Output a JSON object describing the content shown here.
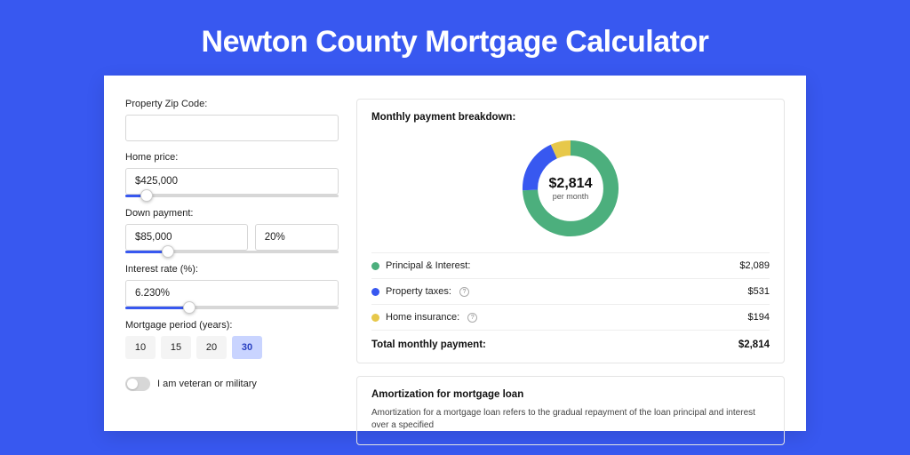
{
  "hero": {
    "title": "Newton County Mortgage Calculator"
  },
  "form": {
    "zip": {
      "label": "Property Zip Code:",
      "value": ""
    },
    "home_price": {
      "label": "Home price:",
      "value": "$425,000",
      "slider_pct": 10
    },
    "down_payment": {
      "label": "Down payment:",
      "amount": "$85,000",
      "percent": "20%",
      "slider_pct": 20
    },
    "interest_rate": {
      "label": "Interest rate (%):",
      "value": "6.230%",
      "slider_pct": 30
    },
    "period": {
      "label": "Mortgage period (years):",
      "options": [
        "10",
        "15",
        "20",
        "30"
      ],
      "selected": "30"
    },
    "veteran": {
      "label": "I am veteran or military",
      "on": false
    }
  },
  "breakdown": {
    "title": "Monthly payment breakdown:",
    "center_amount": "$2,814",
    "center_sub": "per month",
    "items": [
      {
        "label": "Principal & Interest:",
        "value": "$2,089",
        "color": "green",
        "info": false
      },
      {
        "label": "Property taxes:",
        "value": "$531",
        "color": "blue",
        "info": true
      },
      {
        "label": "Home insurance:",
        "value": "$194",
        "color": "yellow",
        "info": true
      }
    ],
    "total_label": "Total monthly payment:",
    "total_value": "$2,814"
  },
  "amort": {
    "title": "Amortization for mortgage loan",
    "text": "Amortization for a mortgage loan refers to the gradual repayment of the loan principal and interest over a specified"
  },
  "chart_data": {
    "type": "pie",
    "title": "Monthly payment breakdown",
    "series": [
      {
        "name": "Principal & Interest",
        "value": 2089,
        "color": "#4caf7d"
      },
      {
        "name": "Property taxes",
        "value": 531,
        "color": "#3858f0"
      },
      {
        "name": "Home insurance",
        "value": 194,
        "color": "#e7c84a"
      }
    ],
    "total": 2814,
    "ylabel": "",
    "xlabel": ""
  }
}
